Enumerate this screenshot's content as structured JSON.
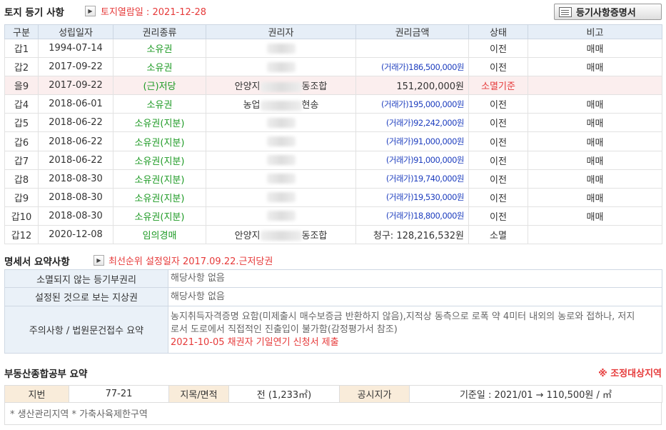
{
  "land": {
    "title": "토지 등기 사항",
    "view_date": "토지열람일 : 2021-12-28",
    "cert_button": "등기사항증명서",
    "columns": [
      "구분",
      "성립일자",
      "권리종류",
      "권리자",
      "권리금액",
      "상태",
      "비고"
    ],
    "rows": [
      {
        "id": "갑1",
        "date": "1994-07-14",
        "type": "소유권",
        "holder_pre": "",
        "holder_post": "",
        "amount_pre": "",
        "amount": "",
        "status": "이전",
        "note": "매매",
        "hl": false
      },
      {
        "id": "갑2",
        "date": "2017-09-22",
        "type": "소유권",
        "holder_pre": "",
        "holder_post": "",
        "amount_pre": "(거래가)",
        "amount": "186,500,000원",
        "status": "이전",
        "note": "매매",
        "hl": false
      },
      {
        "id": "을9",
        "date": "2017-09-22",
        "type": "(근)저당",
        "holder_pre": "안양지",
        "holder_post": "동조합",
        "amount_pre": "",
        "amount": "151,200,000원",
        "status": "소멸기준",
        "note": "",
        "hl": true
      },
      {
        "id": "갑4",
        "date": "2018-06-01",
        "type": "소유권",
        "holder_pre": "농업",
        "holder_post": "현송",
        "amount_pre": "(거래가)",
        "amount": "195,000,000원",
        "status": "이전",
        "note": "매매",
        "hl": false
      },
      {
        "id": "갑5",
        "date": "2018-06-22",
        "type": "소유권(지분)",
        "holder_pre": "",
        "holder_post": "",
        "amount_pre": "(거래가)",
        "amount": "92,242,000원",
        "status": "이전",
        "note": "매매",
        "hl": false
      },
      {
        "id": "갑6",
        "date": "2018-06-22",
        "type": "소유권(지분)",
        "holder_pre": "",
        "holder_post": "",
        "amount_pre": "(거래가)",
        "amount": "91,000,000원",
        "status": "이전",
        "note": "매매",
        "hl": false
      },
      {
        "id": "갑7",
        "date": "2018-06-22",
        "type": "소유권(지분)",
        "holder_pre": "",
        "holder_post": "",
        "amount_pre": "(거래가)",
        "amount": "91,000,000원",
        "status": "이전",
        "note": "매매",
        "hl": false
      },
      {
        "id": "갑8",
        "date": "2018-08-30",
        "type": "소유권(지분)",
        "holder_pre": "",
        "holder_post": "",
        "amount_pre": "(거래가)",
        "amount": "19,740,000원",
        "status": "이전",
        "note": "매매",
        "hl": false
      },
      {
        "id": "갑9",
        "date": "2018-08-30",
        "type": "소유권(지분)",
        "holder_pre": "",
        "holder_post": "",
        "amount_pre": "(거래가)",
        "amount": "19,530,000원",
        "status": "이전",
        "note": "매매",
        "hl": false
      },
      {
        "id": "갑10",
        "date": "2018-08-30",
        "type": "소유권(지분)",
        "holder_pre": "",
        "holder_post": "",
        "amount_pre": "(거래가)",
        "amount": "18,800,000원",
        "status": "이전",
        "note": "매매",
        "hl": false
      },
      {
        "id": "갑12",
        "date": "2020-12-08",
        "type": "임의경매",
        "holder_pre": "안양지",
        "holder_post": "동조합",
        "amount_pre": "",
        "amount": "청구: 128,216,532원",
        "status": "소멸",
        "note": "",
        "hl": false
      }
    ]
  },
  "statement": {
    "title": "명세서 요약사항",
    "priority": "최선순위 설정일자 2017.09.22.근저당권",
    "rows": [
      {
        "key": "소멸되지 않는 등기부권리",
        "value": "해당사항 없음"
      },
      {
        "key": "설정된 것으로 보는 지상권",
        "value": "해당사항 없음"
      },
      {
        "key": "주의사항 / 법원문건접수 요약",
        "value": "농지취득자격증명 요함(미제출시 매수보증금 반환하지 않음),지적상 동측으로 로폭 약 4미터 내외의 농로와 접하나, 저지로서 도로에서 직접적인 진출입이 불가함(감정평가서 참조)",
        "extra": "2021-10-05 채권자 기일연기 신청서 제출"
      }
    ]
  },
  "property": {
    "title": "부동산종합공부 요약",
    "alert": "※ 조정대상지역",
    "lot_label": "지번",
    "lot_value": "77-21",
    "category_label": "지목/면적",
    "category_value": "전 (1,233㎡)",
    "price_label": "공시지가",
    "price_value": "기준일 : 2021/01 → 110,500원 / ㎡",
    "notes": "* 생산관리지역 * 가축사육제한구역"
  },
  "colors": {
    "green": "#1d9a24",
    "blue": "#1f3fbf",
    "red": "#e63a3a",
    "header_bg": "#e6eef7",
    "highlight_bg": "#fbeeee"
  }
}
